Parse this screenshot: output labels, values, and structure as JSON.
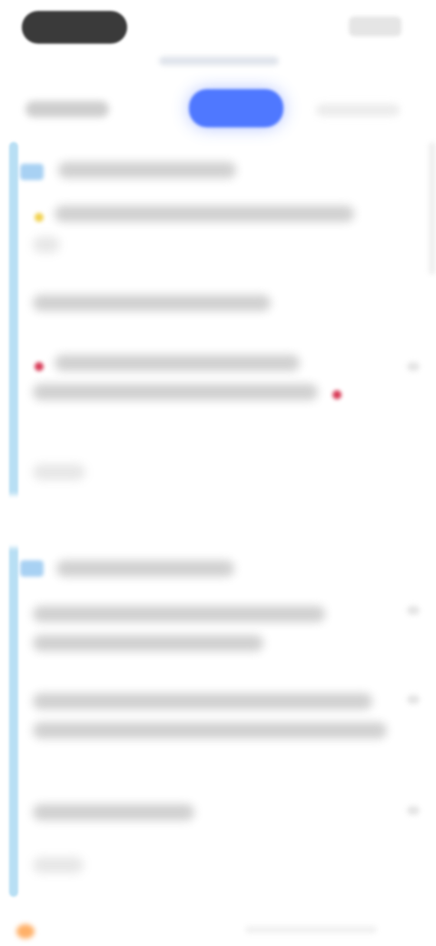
{
  "app": {},
  "toolbar": {},
  "content": {},
  "colors": {
    "accent": "#4f78ff",
    "timeline": "#b8dff4",
    "marker": "#a8d1f3",
    "warning": "#f1d14e",
    "error": "#d73a56",
    "orange": "#ffb067"
  },
  "icons": {
    "yellow_dot": "yellow-status-icon",
    "red_dot": "red-status-icon",
    "chevron": "chevron-down-icon",
    "bottom_orange": "orange-status-icon"
  }
}
